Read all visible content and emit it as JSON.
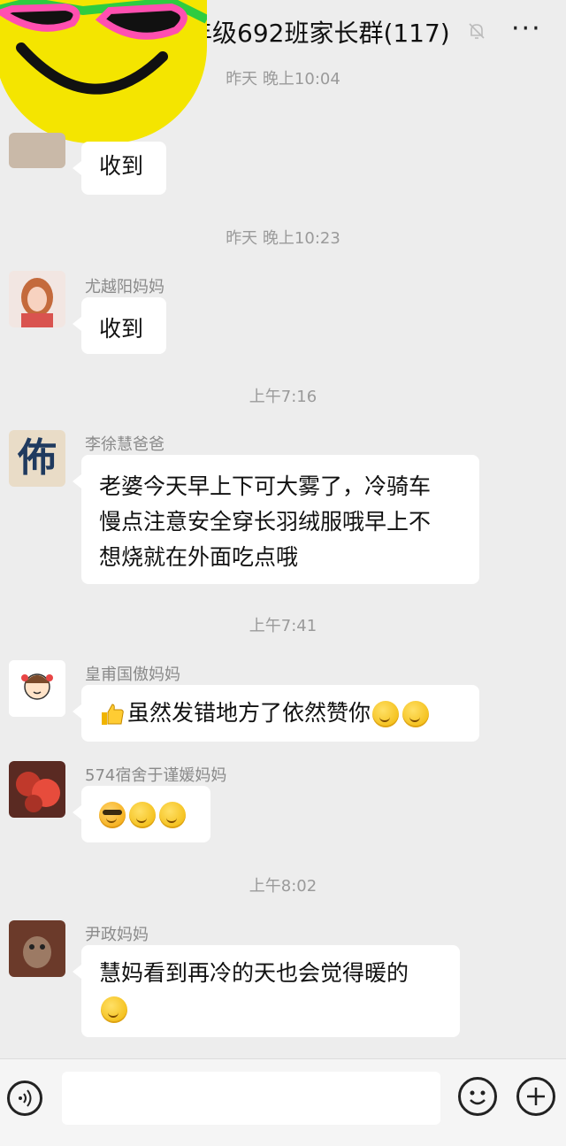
{
  "header": {
    "title": "年级692班家长群(117)",
    "more_label": "···"
  },
  "messages": {
    "t1": "昨天 晚上10:04",
    "m1_text": "收到",
    "t2": "昨天 晚上10:23",
    "m2_sender": "尤越阳妈妈",
    "m2_text": "收到",
    "t3": "上午7:16",
    "m3_sender": "李徐慧爸爸",
    "m3_line1": "老婆今天早上下可大雾了，冷骑车",
    "m3_line2": "慢点注意安全穿长羽绒服哦早上不",
    "m3_line3": "想烧就在外面吃点哦",
    "m3_avatar_glyph": "佈",
    "t4": "上午7:41",
    "m4_sender": "皇甫国傲妈妈",
    "m4_text": "虽然发错地方了依然赞你",
    "m5_sender": "574宿舍于谨媛妈妈",
    "t5": "上午8:02",
    "m6_sender": "尹政妈妈",
    "m6_text": "慧妈看到再冷的天也会觉得暖的"
  },
  "icons": [
    "mute-bell-icon",
    "more-icon",
    "voice-icon",
    "emoji-face-icon",
    "plus-icon",
    "thumbs-up-icon",
    "smirk-emoji-icon",
    "cool-emoji-icon"
  ]
}
